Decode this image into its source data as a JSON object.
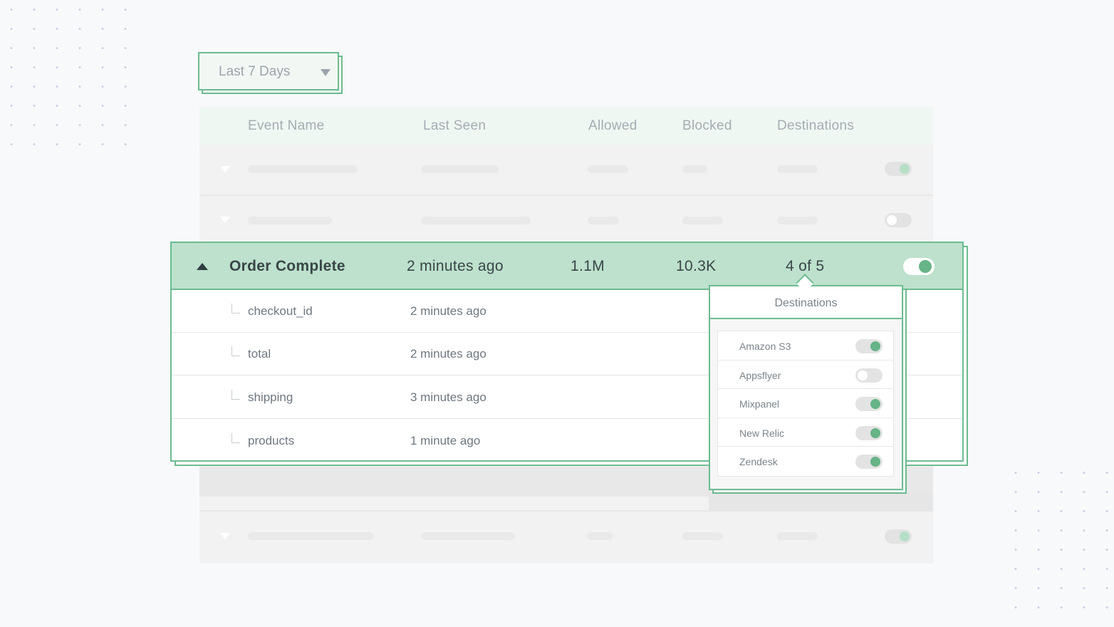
{
  "filter": {
    "label": "Last 7 Days",
    "caret_icon": "caret-down-icon"
  },
  "table": {
    "headers": [
      "Event Name",
      "Last Seen",
      "Allowed",
      "Blocked",
      "Destinations"
    ],
    "ghost_rows": [
      {
        "enabled": true
      },
      {
        "enabled": false
      },
      {
        "enabled": true
      }
    ],
    "expanded_event": {
      "name": "Order Complete",
      "last_seen": "2 minutes ago",
      "allowed": "1.1M",
      "blocked": "10.3K",
      "destinations": "4 of 5",
      "enabled": true,
      "properties": [
        {
          "name": "checkout_id",
          "last_seen": "2 minutes ago"
        },
        {
          "name": "total",
          "last_seen": "2 minutes ago"
        },
        {
          "name": "shipping",
          "last_seen": "3 minutes ago"
        },
        {
          "name": "products",
          "last_seen": "1 minute ago"
        }
      ]
    }
  },
  "popover": {
    "title": "Destinations",
    "items": [
      {
        "name": "Amazon S3",
        "enabled": true
      },
      {
        "name": "Appsflyer",
        "enabled": false
      },
      {
        "name": "Mixpanel",
        "enabled": true
      },
      {
        "name": "New Relic",
        "enabled": true
      },
      {
        "name": "Zendesk",
        "enabled": true
      }
    ]
  },
  "colors": {
    "accent": "#6dbb90",
    "accent_fill": "#bde1cc",
    "toggle_on": "#66b487",
    "header_bg": "#eef7f2"
  }
}
